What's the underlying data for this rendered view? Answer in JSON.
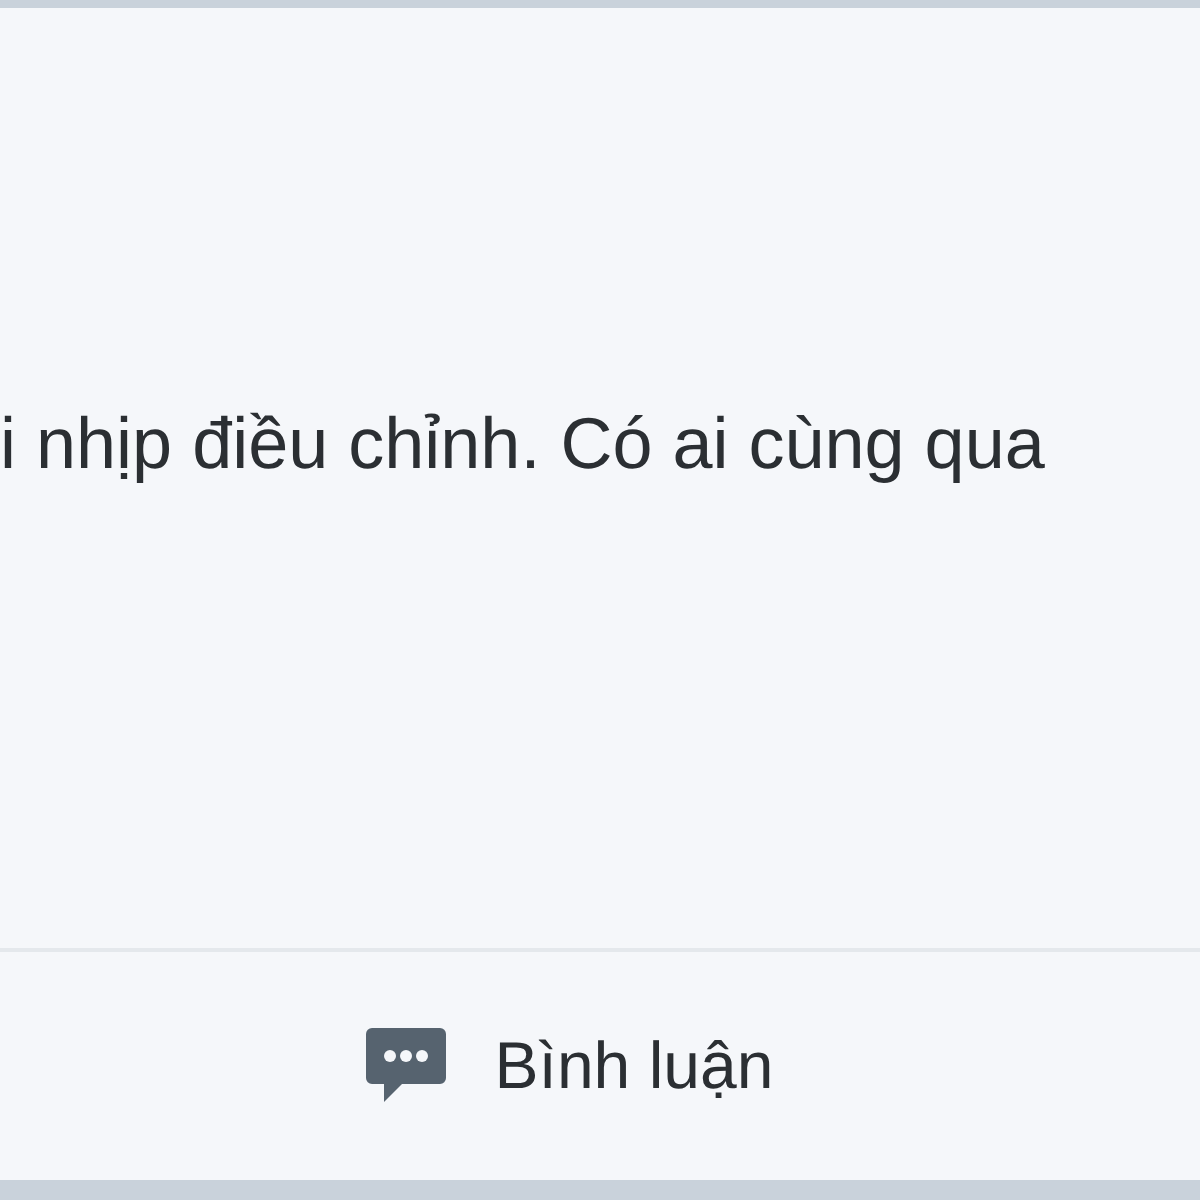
{
  "post": {
    "text": "i nhịp điều chỉnh. Có ai cùng qua"
  },
  "actions": [
    {
      "kind": "comment",
      "label": "Bình luận"
    }
  ]
}
